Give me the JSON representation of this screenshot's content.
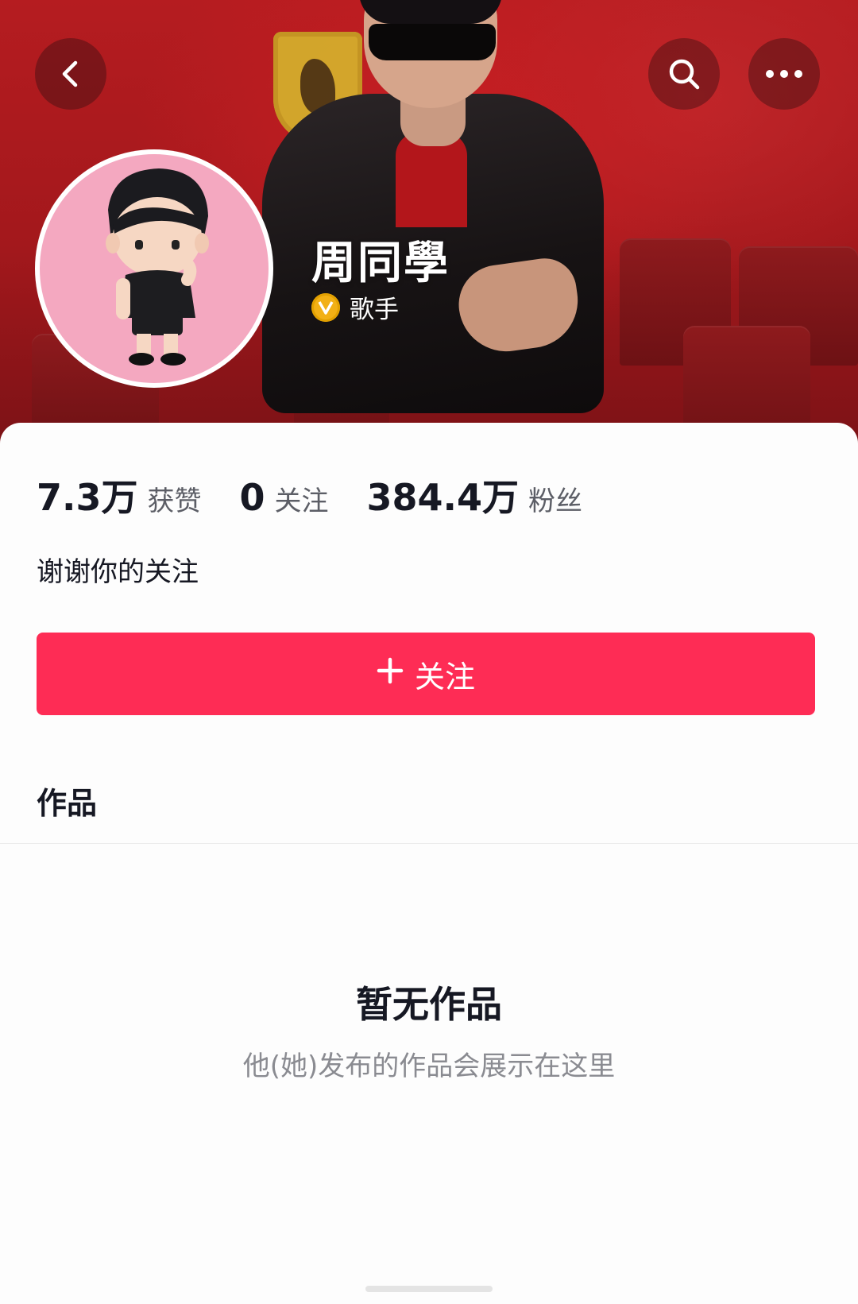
{
  "header": {
    "name": "周同學",
    "tag": "歌手"
  },
  "stats": [
    {
      "value": "7.3万",
      "label": "获赞"
    },
    {
      "value": "0",
      "label": "关注"
    },
    {
      "value": "384.4万",
      "label": "粉丝"
    }
  ],
  "bio": "谢谢你的关注",
  "follow_button": {
    "icon": "plus-icon",
    "label": "关注"
  },
  "works": {
    "title": "作品"
  },
  "empty_state": {
    "title": "暂无作品",
    "subtitle": "他(她)发布的作品会展示在这里"
  },
  "colors": {
    "accent": "#fe2c55",
    "banner": "#b51c20",
    "badge": "#f2b015",
    "avatar_bg": "#f4a8c0"
  },
  "icons": [
    "back-arrow-icon",
    "search-icon",
    "more-icon",
    "verified-badge-icon"
  ]
}
